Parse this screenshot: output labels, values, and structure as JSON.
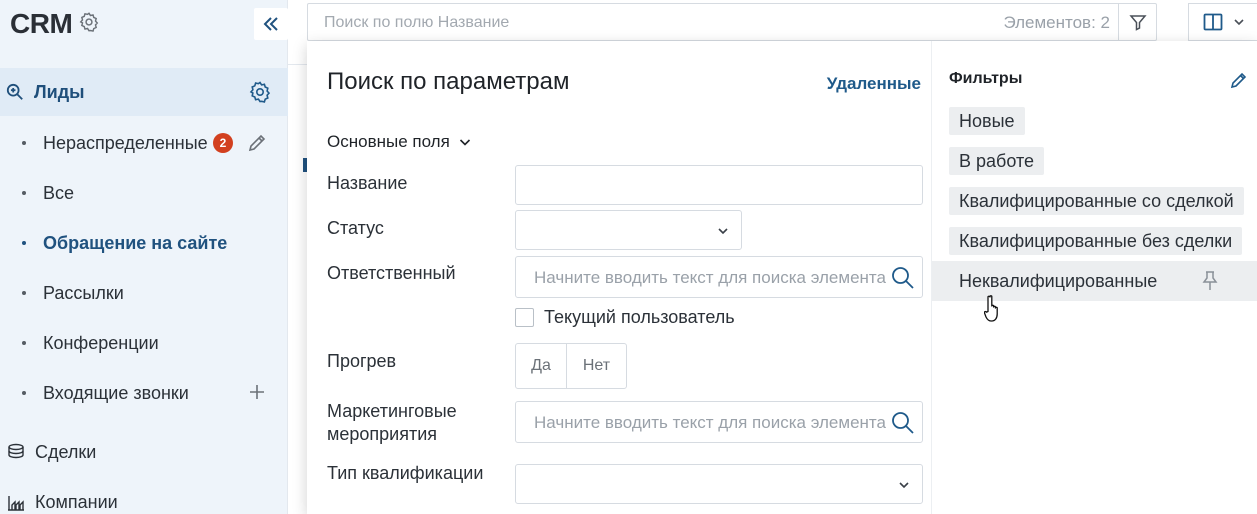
{
  "sidebar": {
    "title": "CRM",
    "section": {
      "label": "Лиды"
    },
    "items": [
      {
        "label": "Нераспределенные",
        "badge": "2"
      },
      {
        "label": "Все"
      },
      {
        "label": "Обращение на сайте"
      },
      {
        "label": "Рассылки"
      },
      {
        "label": "Конференции"
      },
      {
        "label": "Входящие звонки"
      }
    ],
    "main": [
      {
        "label": "Сделки",
        "icon": "coins-icon"
      },
      {
        "label": "Компании",
        "icon": "company-icon"
      }
    ]
  },
  "topbar": {
    "search_placeholder": "Поиск по полю Название",
    "count_label": "Элементов: 2"
  },
  "popup": {
    "title": "Поиск по параметрам",
    "deleted_link": "Удаленные",
    "group_label": "Основные поля",
    "fields": {
      "name_label": "Название",
      "status_label": "Статус",
      "responsible_label": "Ответственный",
      "responsible_placeholder": "Начните вводить текст для поиска элемента",
      "current_user_label": "Текущий пользователь",
      "warmup_label": "Прогрев",
      "warmup_yes": "Да",
      "warmup_no": "Нет",
      "marketing_label_1": "Маркетинговые",
      "marketing_label_2": "мероприятия",
      "marketing_placeholder": "Начните вводить текст для поиска элемента",
      "qualification_label": "Тип квалификации"
    },
    "filters": {
      "title": "Фильтры",
      "items": [
        "Новые",
        "В работе",
        "Квалифицированные со сделкой",
        "Квалифицированные без сделки",
        "Неквалифицированные"
      ]
    }
  },
  "colors": {
    "accent": "#20527f",
    "badge": "#d2401f",
    "sidebar_bg": "#eef4fa"
  }
}
